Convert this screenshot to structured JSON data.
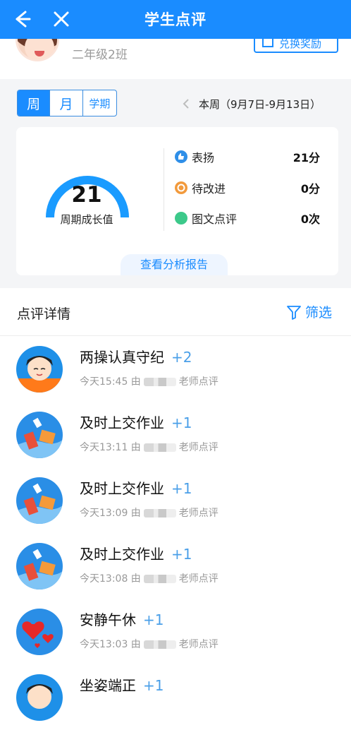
{
  "header": {
    "title": "学生点评"
  },
  "profile": {
    "class_name": "二年级2班",
    "exchange_label": "兑换奖励"
  },
  "period": {
    "tabs": [
      "周",
      "月",
      "学期"
    ],
    "active": 0,
    "current_range": "本周（9月7日-9月13日）"
  },
  "summary": {
    "growth_value": "21",
    "growth_label": "周期成长值",
    "stats": [
      {
        "name": "表扬",
        "value": "21分",
        "color": "#2f8fe8",
        "icon": "thumb-up-icon"
      },
      {
        "name": "待改进",
        "value": "0分",
        "color": "#f29a3c",
        "icon": "warning-icon"
      },
      {
        "name": "图文点评",
        "value": "0次",
        "color": "#3cc98a",
        "icon": "image-comment-icon"
      }
    ],
    "report_button": "查看分析报告"
  },
  "detail": {
    "title": "点评详情",
    "filter_label": "筛选",
    "items": [
      {
        "title": "两操认真守纪",
        "points": "+2",
        "time": "今天15:45 由",
        "suffix": "老师点评",
        "avatar": "boy"
      },
      {
        "title": "及时上交作业",
        "points": "+1",
        "time": "今天13:11 由",
        "suffix": "老师点评",
        "avatar": "books"
      },
      {
        "title": "及时上交作业",
        "points": "+1",
        "time": "今天13:09 由",
        "suffix": "老师点评",
        "avatar": "books"
      },
      {
        "title": "及时上交作业",
        "points": "+1",
        "time": "今天13:08 由",
        "suffix": "老师点评",
        "avatar": "books"
      },
      {
        "title": "安静午休",
        "points": "+1",
        "time": "今天13:03 由",
        "suffix": "老师点评",
        "avatar": "hearts"
      },
      {
        "title": "坐姿端正",
        "points": "+1",
        "time": "",
        "suffix": "",
        "avatar": "boy"
      }
    ]
  }
}
